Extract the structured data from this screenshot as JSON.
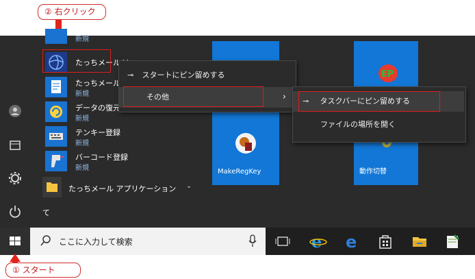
{
  "annotations": {
    "step2_label": "② 右クリック",
    "step1_label": "① スタート"
  },
  "app_list": [
    {
      "name": "",
      "sub": "新規"
    },
    {
      "name": "たっちメール Ve",
      "sub": ""
    },
    {
      "name": "たっちメール操",
      "sub": "新規"
    },
    {
      "name": "データの復元",
      "sub": "新規"
    },
    {
      "name": "テンキー登録",
      "sub": "新規"
    },
    {
      "name": "バーコード登録",
      "sub": "新規"
    }
  ],
  "folder_group": {
    "label": "たっちメール アプリケーション"
  },
  "section_letter": "て",
  "context_menu": {
    "pin_start": "スタートにピン留めする",
    "more": "その他"
  },
  "submenu": {
    "pin_taskbar": "タスクバーにピン留めする",
    "open_location": "ファイルの場所を開く"
  },
  "tiles": [
    {
      "label": ""
    },
    {
      "label": "MakeRegKey"
    },
    {
      "label": "動作切替"
    }
  ],
  "taskbar": {
    "search_placeholder": "ここに入力して検索"
  },
  "colors": {
    "accent_red": "#e2231a",
    "tile_blue": "#1277d6",
    "menu_bg": "#2b2b2b"
  }
}
